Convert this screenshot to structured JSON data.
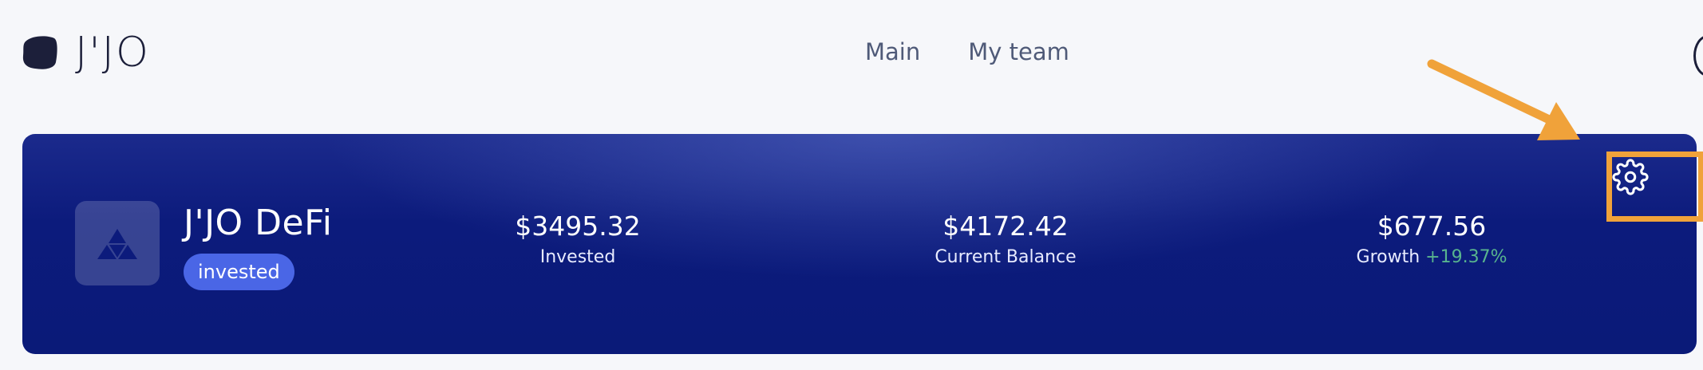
{
  "header": {
    "logo_text": "J'JO",
    "nav": [
      {
        "label": "Main"
      },
      {
        "label": "My team"
      }
    ]
  },
  "card": {
    "token_name": "J'JO DeFi",
    "status_badge": "invested",
    "stats": {
      "invested": {
        "value": "$3495.32",
        "label": "Invested"
      },
      "current_balance": {
        "value": "$4172.42",
        "label": "Current Balance"
      },
      "growth": {
        "value": "$677.56",
        "label": "Growth",
        "percent": "+19.37%"
      }
    },
    "settings_icon": "gear-icon"
  },
  "annotation": {
    "color": "#f0a23a",
    "arrow_icon": "arrow-icon",
    "target": "settings-button"
  },
  "colors": {
    "card_bg": "#0c1b7c",
    "badge_bg": "#4a66e6",
    "growth_positive": "#58b48e",
    "nav_text": "#4f5a78"
  }
}
